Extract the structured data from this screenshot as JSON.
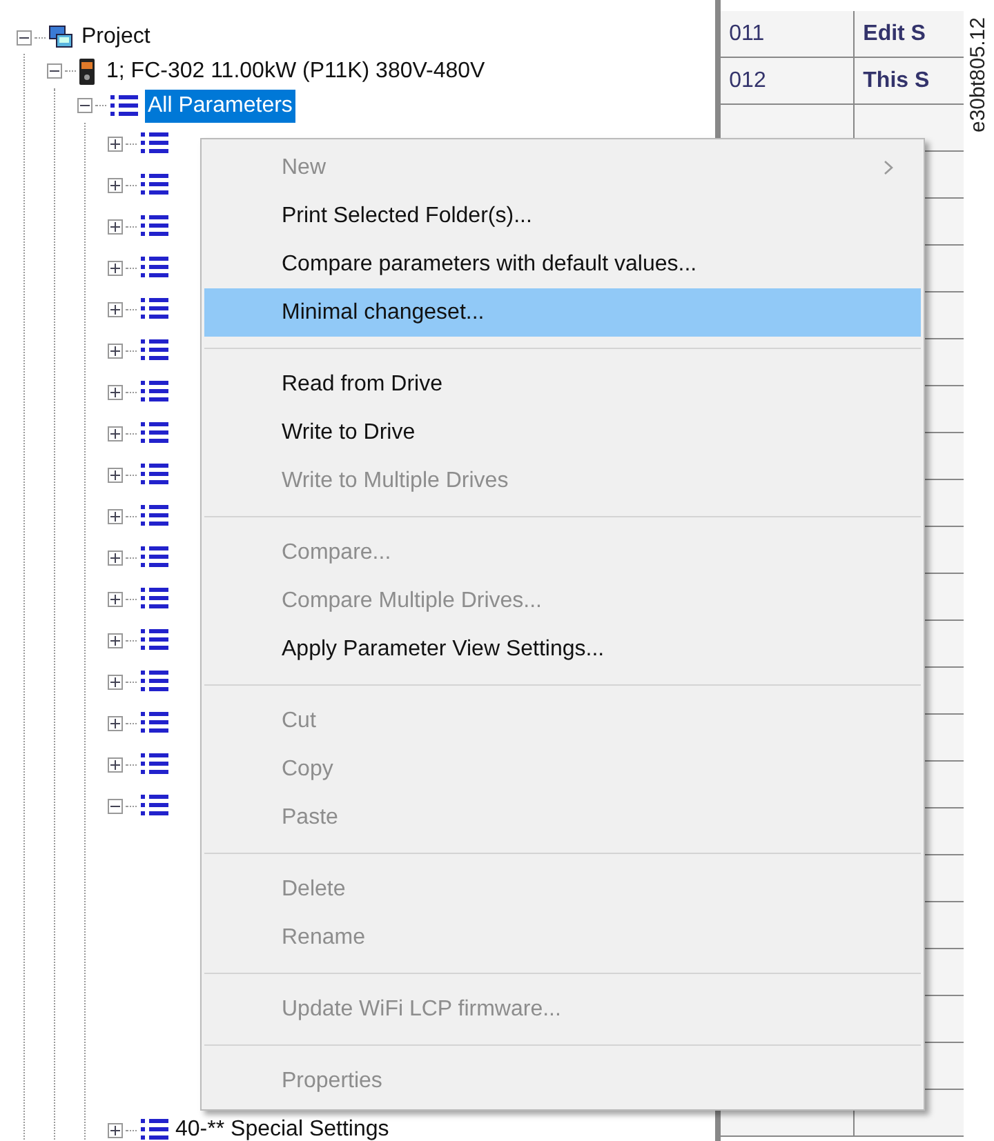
{
  "tree": {
    "label": "Project",
    "expanded": true,
    "children": [
      {
        "label": "1; FC-302 11.00kW (P11K) 380V-480V",
        "expanded": true,
        "children": [
          {
            "label": "All Parameters",
            "expanded": true,
            "selected": true,
            "children": [
              {
                "expanded": false
              },
              {
                "expanded": false
              },
              {
                "expanded": false
              },
              {
                "expanded": false
              },
              {
                "expanded": false
              },
              {
                "expanded": false
              },
              {
                "expanded": false
              },
              {
                "expanded": false
              },
              {
                "expanded": false
              },
              {
                "expanded": false
              },
              {
                "expanded": false
              },
              {
                "expanded": false
              },
              {
                "expanded": false
              },
              {
                "expanded": false
              },
              {
                "expanded": false
              },
              {
                "expanded": false
              },
              {
                "expanded": true
              },
              {
                "label": "40-** Special Settings",
                "expanded": false
              }
            ]
          }
        ]
      }
    ]
  },
  "grid": {
    "rows": [
      {
        "column_1": "011",
        "column_2": "Edit S"
      },
      {
        "column_1": "012",
        "column_2": "This S"
      }
    ]
  },
  "context_menu": {
    "items": [
      {
        "kind": "item",
        "label": "New",
        "disabled": true,
        "submenu": true,
        "selected": false
      },
      {
        "kind": "item",
        "label": "Print Selected Folder(s)...",
        "disabled": false,
        "selected": false
      },
      {
        "kind": "item",
        "label": "Compare parameters with default values...",
        "disabled": false,
        "selected": false
      },
      {
        "kind": "item",
        "label": "Minimal changeset...",
        "disabled": false,
        "selected": true
      },
      {
        "kind": "separator"
      },
      {
        "kind": "item",
        "label": "Read from Drive",
        "disabled": false,
        "selected": false
      },
      {
        "kind": "item",
        "label": "Write to Drive",
        "disabled": false,
        "selected": false
      },
      {
        "kind": "item",
        "label": "Write to Multiple Drives",
        "disabled": true,
        "selected": false
      },
      {
        "kind": "separator"
      },
      {
        "kind": "item",
        "label": "Compare...",
        "disabled": true,
        "selected": false
      },
      {
        "kind": "item",
        "label": "Compare Multiple Drives...",
        "disabled": true,
        "selected": false
      },
      {
        "kind": "item",
        "label": "Apply Parameter View Settings...",
        "disabled": false,
        "selected": false
      },
      {
        "kind": "separator"
      },
      {
        "kind": "item",
        "label": "Cut",
        "disabled": true,
        "selected": false
      },
      {
        "kind": "item",
        "label": "Copy",
        "disabled": true,
        "selected": false
      },
      {
        "kind": "item",
        "label": "Paste",
        "disabled": true,
        "selected": false
      },
      {
        "kind": "separator"
      },
      {
        "kind": "item",
        "label": "Delete",
        "disabled": true,
        "selected": false
      },
      {
        "kind": "item",
        "label": "Rename",
        "disabled": true,
        "selected": false
      },
      {
        "kind": "separator"
      },
      {
        "kind": "item",
        "label": "Update WiFi LCP firmware...",
        "disabled": true,
        "selected": false
      },
      {
        "kind": "separator"
      },
      {
        "kind": "item",
        "label": "Properties",
        "disabled": true,
        "selected": false
      }
    ]
  },
  "figure_id": "e30bt805.12"
}
